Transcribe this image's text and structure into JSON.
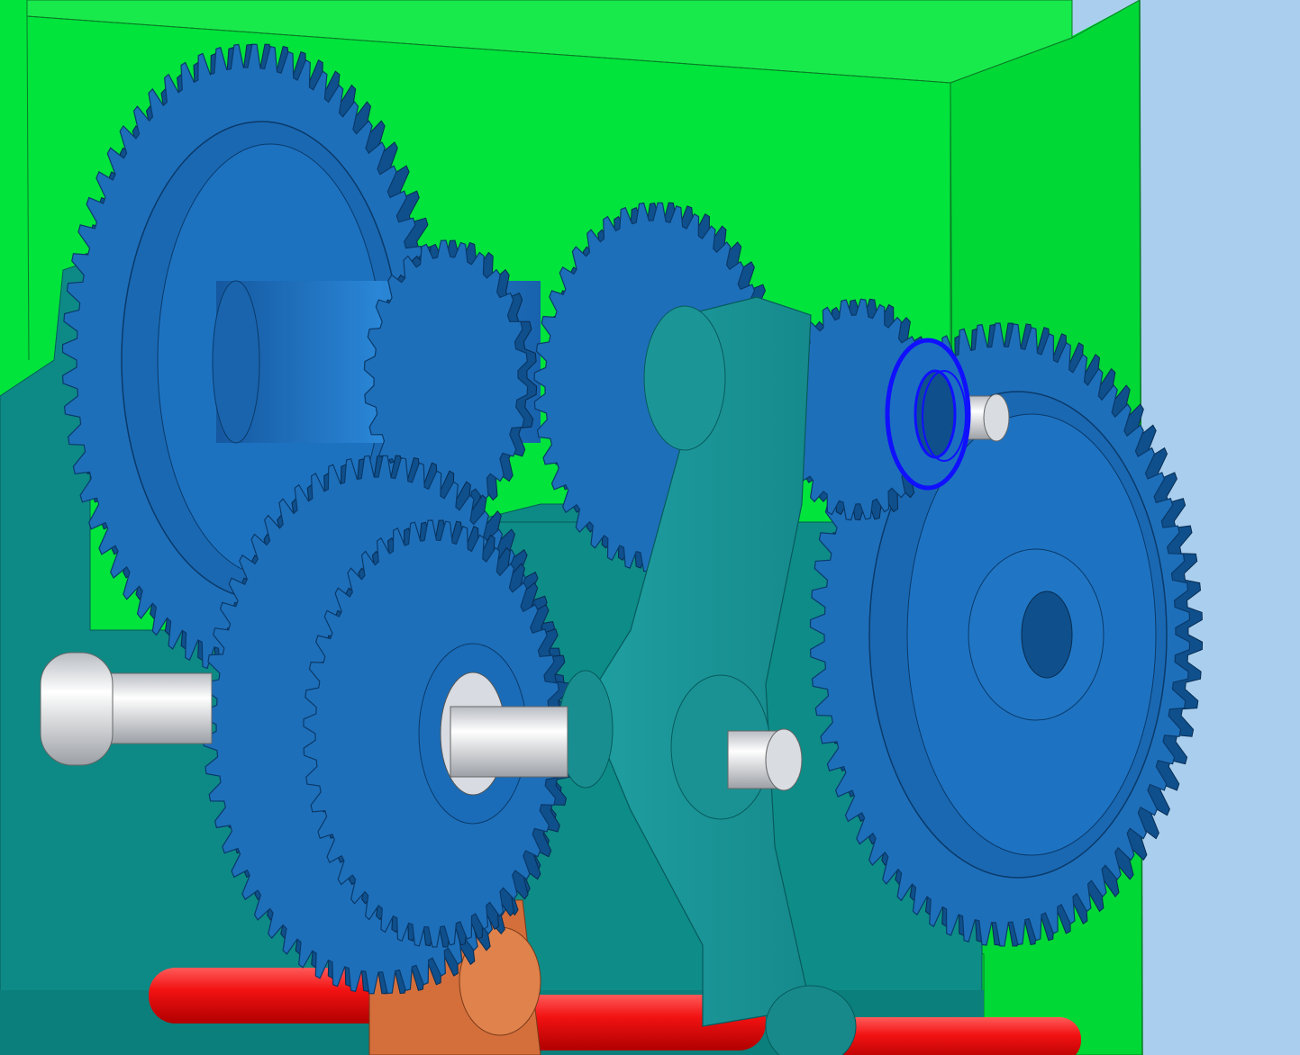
{
  "viewport": {
    "background_color": "#aacfee"
  },
  "colors": {
    "housing": "#00e43c",
    "housing_side": "#00d336",
    "housing_top": "#11e946",
    "base_plate": "#0d8a86",
    "arm": "#1a9ea0",
    "gear": "#1e6fba",
    "gear_dark": "#0f4f8c",
    "gear_face": "#1a68b2",
    "shaft_pin": "#eceef1",
    "selected_edge": "#1010ff",
    "red_rod": "#ec1010",
    "orange_bracket": "#d46f3c"
  },
  "components": [
    {
      "name": "housing-plate",
      "icon": "box-icon"
    },
    {
      "name": "large-spur-gear-upper-left",
      "icon": "gear-icon"
    },
    {
      "name": "compound-gear-upper-center",
      "icon": "gear-icon"
    },
    {
      "name": "idler-gear-upper",
      "icon": "gear-icon"
    },
    {
      "name": "large-spur-gear-right",
      "icon": "gear-icon"
    },
    {
      "name": "pinion-gear-right",
      "icon": "gear-icon"
    },
    {
      "name": "lower-double-gear",
      "icon": "gear-icon"
    },
    {
      "name": "swing-arm",
      "icon": "lever-icon"
    },
    {
      "name": "selected-washer",
      "icon": "ring-icon"
    },
    {
      "name": "red-lead-screw",
      "icon": "rod-icon"
    },
    {
      "name": "orange-bracket",
      "icon": "bracket-icon"
    }
  ]
}
